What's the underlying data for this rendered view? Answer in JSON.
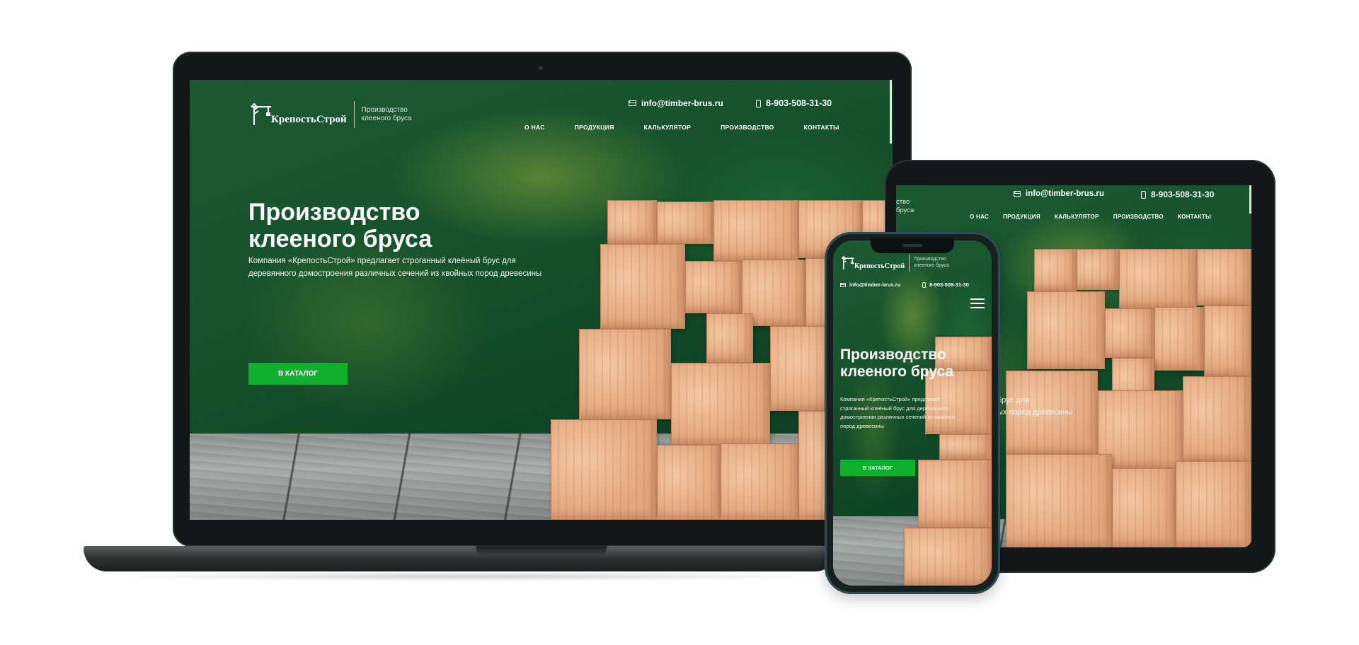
{
  "site": {
    "logo_name": "КрепостьСтрой",
    "logo_tagline": "Производство клееного бруса",
    "email": "info@timber-brus.ru",
    "phone": "8-903-508-31-30",
    "nav": [
      {
        "label": "О НАС"
      },
      {
        "label": "ПРОДУКЦИЯ"
      },
      {
        "label": "КАЛЬКУЛЯТОР"
      },
      {
        "label": "ПРОИЗВОДСТВО"
      },
      {
        "label": "КОНТАКТЫ"
      }
    ],
    "hero_title_line1": "Производство",
    "hero_title_line2": "клееного бруса",
    "hero_text": "Компания «КрепостьСтрой» предлагает строганный клеёный брус для деревянного домостроения различных сечений из хвойных пород древесины",
    "hero_text_line1": "Компания «КрепостьСтрой» предлагает строганный клеёный брус для",
    "hero_text_line2": "деревянного домостроения различных сечений из хвойных пород древесины",
    "tablet_tagline_fragment": "ство бруса",
    "tablet_text_fragment_1": "брус для",
    "tablet_text_fragment_2": "ых пород древесины",
    "cta_label": "В КАТАЛОГ"
  },
  "icons": {
    "email": "mail-icon",
    "phone": "phone-icon",
    "menu": "hamburger-icon",
    "logo": "crane-logo-icon"
  },
  "colors": {
    "accent": "#10b02f",
    "hero_green": "#16522c",
    "device": "#141718"
  }
}
